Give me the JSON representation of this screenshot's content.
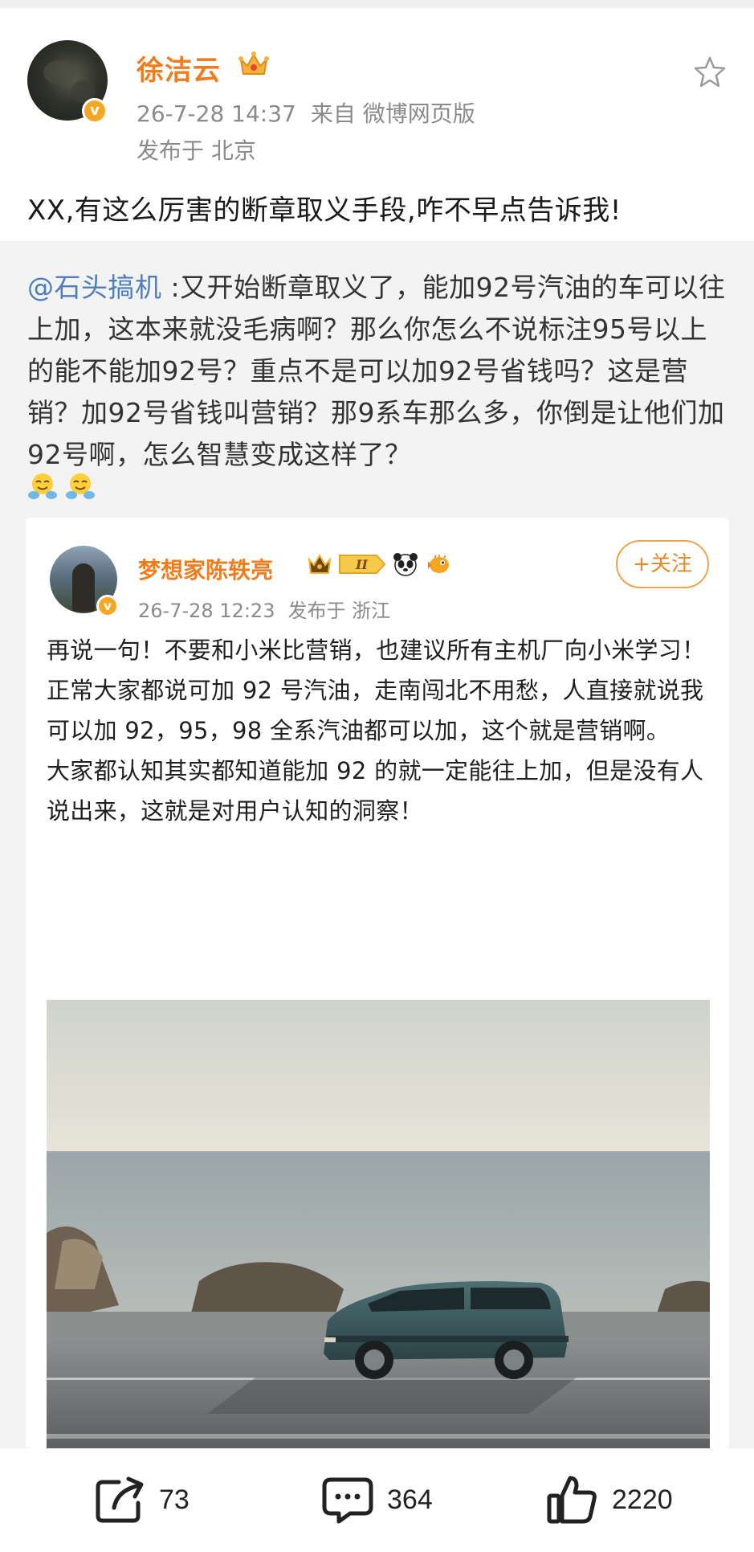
{
  "post": {
    "author": "徐洁云",
    "date": "26-7-28 14:37",
    "source": "来自 微博网页版",
    "location": "发布于 北京",
    "text": "XX,有这么厉害的断章取义手段,咋不早点告诉我!"
  },
  "repost": {
    "mention": "@石头搞机",
    "text": " :又开始断章取义了，能加92号汽油的车可以往上加，这本来就没毛病啊？那么你怎么不说标注95号以上的能不能加92号？重点不是可以加92号省钱吗？这是营销？加92号省钱叫营销？那9系车那么多，你倒是让他们加92号啊，怎么智慧变成这样了？",
    "emojis": [
      "hug-emoji",
      "hug-emoji"
    ]
  },
  "card": {
    "author": "梦想家陈轶亮",
    "badges": [
      "crown-badge",
      "level-II-badge",
      "panda-badge",
      "pufferfish-badge"
    ],
    "level_label": "II",
    "date": "26-7-28 12:23",
    "location": "发布于 浙江",
    "follow_label": "+关注",
    "paragraphs": [
      "再说一句！不要和小米比营销，也建议所有主机厂向小米学习！",
      "正常大家都说可加 92 号汽油，走南闯北不用愁，人直接就说我可以加 92，95，98 全系汽油都可以加，这个就是营销啊。",
      "大家都认知其实都知道能加 92 的就一定能往上加，但是没有人说出来，这就是对用户认知的洞察！"
    ]
  },
  "actions": {
    "share_count": "73",
    "comment_count": "364",
    "like_count": "2220"
  },
  "colors": {
    "username": "#f07d1d",
    "mention": "#4e7fb8",
    "meta": "#8a8a8a",
    "repost_bg": "#f3f3f3"
  }
}
